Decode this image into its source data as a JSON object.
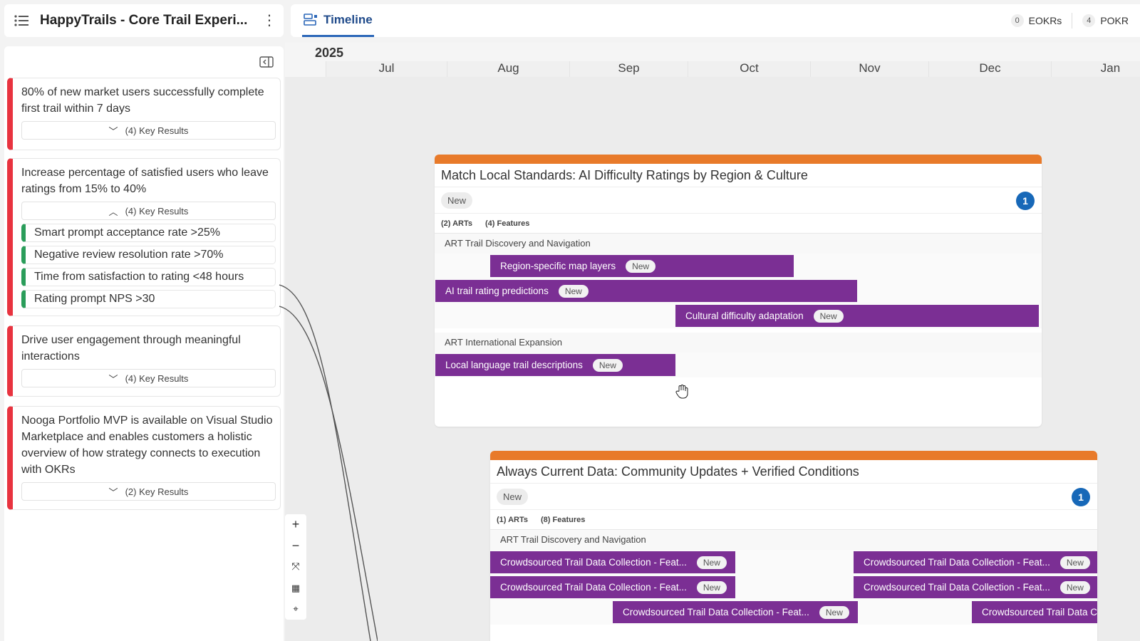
{
  "header": {
    "project_title": "HappyTrails - Core Trail Experi...",
    "timeline_tab": "Timeline",
    "counters": [
      {
        "count": "0",
        "label": "EOKRs"
      },
      {
        "count": "4",
        "label": "POKR"
      }
    ]
  },
  "okrs": [
    {
      "text": "80% of new market users successfully complete first trail within 7 days",
      "toggle": "(4) Key Results",
      "expanded": false
    },
    {
      "text": "Increase percentage of satisfied users who leave ratings from 15% to 40%",
      "toggle": "(4) Key Results",
      "expanded": true,
      "key_results": [
        "Smart prompt acceptance rate >25%",
        "Negative review resolution rate >70%",
        "Time from satisfaction to rating <48 hours",
        "Rating prompt NPS >30"
      ]
    },
    {
      "text": "Drive user engagement through meaningful interactions",
      "toggle": "(4) Key Results",
      "expanded": false
    },
    {
      "text": "Nooga Portfolio MVP is available on Visual Studio Marketplace and enables customers a holistic overview of how strategy connects to execution with OKRs",
      "toggle": "(2) Key Results",
      "expanded": false
    }
  ],
  "timeline": {
    "year": "2025",
    "months": [
      "Jul",
      "Aug",
      "Sep",
      "Oct",
      "Nov",
      "Dec",
      "Jan"
    ]
  },
  "epics": [
    {
      "title": "Match Local Standards: AI Difficulty Ratings by Region & Culture",
      "status": "New",
      "badge": "1",
      "arts_count": "(2) ARTs",
      "features_count": "(4) Features",
      "arts": [
        {
          "name": "ART Trail Discovery and Navigation",
          "features": [
            "Region-specific map layers",
            "AI trail rating predictions",
            "Cultural difficulty adaptation"
          ]
        },
        {
          "name": "ART International Expansion",
          "features": [
            "Local language trail descriptions"
          ]
        }
      ]
    },
    {
      "title": "Always Current Data: Community Updates + Verified Conditions",
      "status": "New",
      "badge": "1",
      "arts_count": "(1) ARTs",
      "features_count": "(8) Features",
      "arts": [
        {
          "name": "ART Trail Discovery and Navigation",
          "features": [
            "Crowdsourced Trail Data Collection - Feat...",
            "Crowdsourced Trail Data Collection - Feat...",
            "Crowdsourced Trail Data Collection - Feat...",
            "Crowdsourced Trail Data Collection - Feat...",
            "Crowdsourced Trail Data Collection - Feat...",
            "Crowdsourced Trail Data Collec"
          ]
        }
      ]
    }
  ],
  "feature_status": "New",
  "colors": {
    "okr_accent": "#e8333f",
    "kr_accent": "#2a9d5a",
    "epic_header": "#e87a2a",
    "feature_bar": "#7b2f94",
    "badge": "#1768b8",
    "tab_active": "#2a66b8"
  },
  "zoom_controls": [
    "plus-icon",
    "minus-icon",
    "fit-icon",
    "grid-icon",
    "locate-icon"
  ]
}
